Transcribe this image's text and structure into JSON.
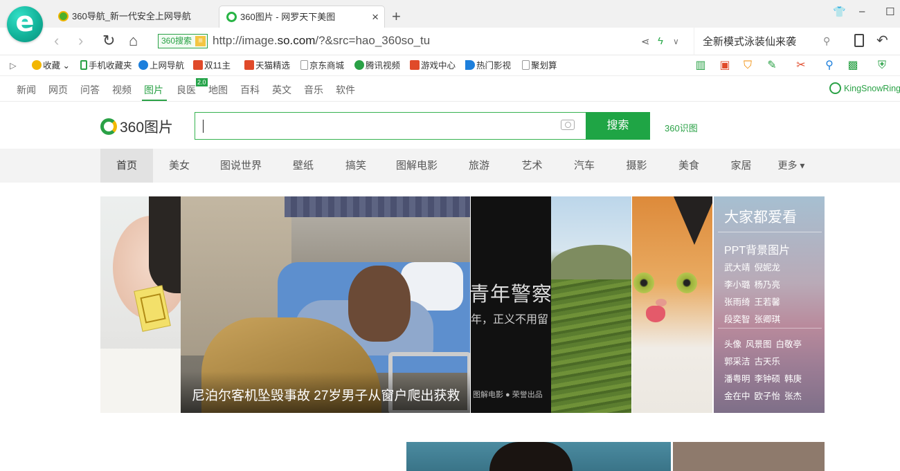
{
  "browser": {
    "tabs": [
      {
        "title": "360导航_新一代安全上网导航"
      },
      {
        "title": "360图片 - 网罗天下美图",
        "close": "×"
      }
    ],
    "new_tab": "+",
    "window_controls": {
      "shirt": "👕",
      "minimize": "–",
      "maximize": "☐"
    },
    "nav": {
      "back": "‹",
      "forward": "›",
      "refresh": "↻",
      "home": "⌂"
    },
    "address": {
      "badge": "360搜索",
      "url_prefix": "http://image.",
      "url_domain": "so.com",
      "url_suffix": "/?&src=hao_360so_tu"
    },
    "address_search": {
      "value": "全新模式泳装仙来袭"
    },
    "favorites": [
      {
        "label": "收藏",
        "icon": "star-icon",
        "color": "#f2b600"
      },
      {
        "label": "手机收藏夹",
        "icon": "phone-icon",
        "color": "#2aa146"
      },
      {
        "label": "上网导航",
        "icon": "e-icon",
        "color": "#1d7fdc"
      },
      {
        "label": "双11主",
        "icon": "20-icon",
        "color": "#e04a2a"
      },
      {
        "label": "天猫精选",
        "icon": "20-icon",
        "color": "#e04a2a"
      },
      {
        "label": "京东商城",
        "icon": "page-icon",
        "color": "#888888"
      },
      {
        "label": "腾讯视频",
        "icon": "play-icon",
        "color": "#2aa146"
      },
      {
        "label": "游戏中心",
        "icon": "game-icon",
        "color": "#e04a2a"
      },
      {
        "label": "热门影视",
        "icon": "play-icon",
        "color": "#1d7fdc"
      },
      {
        "label": "聚划算",
        "icon": "page-icon",
        "color": "#888888"
      }
    ]
  },
  "site_nav": {
    "items": [
      "新闻",
      "网页",
      "问答",
      "视频",
      "图片",
      "良医",
      "地图",
      "百科",
      "英文",
      "音乐",
      "软件"
    ],
    "active": "图片",
    "badge": "2.0",
    "user": "KingSnowRing"
  },
  "search": {
    "brand": "360图片",
    "button": "搜索",
    "shitu": "360识图",
    "value": ""
  },
  "categories": {
    "items": [
      "首页",
      "美女",
      "图说世界",
      "壁纸",
      "搞笑",
      "图解电影",
      "旅游",
      "艺术",
      "汽车",
      "摄影",
      "美食",
      "家居",
      "更多 ▾"
    ],
    "active": "首页"
  },
  "mosaic": {
    "news_caption": "尼泊尔客机坠毁事故 27岁男子从窗户爬出获救",
    "movie_title": "青年警察",
    "movie_sub": "年，正义不用留",
    "movie_source": "图解电影 ● 荣誉出品"
  },
  "sidebar_panel": {
    "title": "大家都爱看",
    "subtitle": "PPT背景图片",
    "group1": [
      [
        "武大靖",
        "倪妮龙"
      ],
      [
        "李小璐",
        "杨乃亮"
      ],
      [
        "张雨绮",
        "王若馨"
      ],
      [
        "段奕智",
        "张卿琪"
      ]
    ],
    "group2": [
      [
        "头像",
        "风景图",
        "白敬亭"
      ],
      [
        "郭采洁",
        "古天乐"
      ],
      [
        "潘粤明",
        "李钟硕",
        "韩庚"
      ],
      [
        "金在中",
        "欧子怡",
        "张杰"
      ]
    ]
  }
}
